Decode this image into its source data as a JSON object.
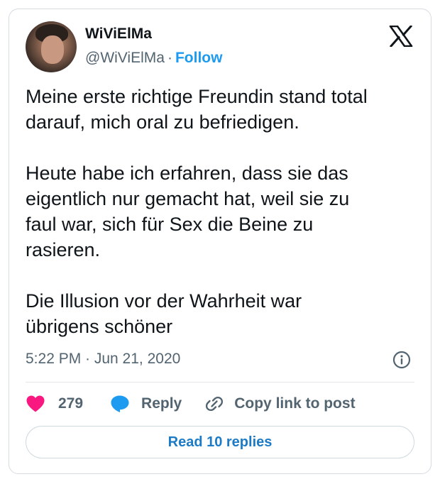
{
  "author": {
    "display_name": "WiViElMa",
    "handle": "@WiViElMa",
    "separator": "·",
    "follow_label": "Follow"
  },
  "tweet": {
    "text": "Meine erste richtige Freundin stand total\ndarauf, mich oral zu befriedigen.\n\nHeute habe ich erfahren, dass sie das\neigentlich nur gemacht hat, weil sie zu\nfaul war, sich für Sex die Beine zu\nrasieren.\n\nDie Illusion vor der Wahrheit war\nübrigens schöner",
    "timestamp": "5:22 PM · Jun 21, 2020"
  },
  "actions": {
    "like_count": "279",
    "reply_label": "Reply",
    "copy_link_label": "Copy link to post"
  },
  "read_replies_label": "Read 10 replies",
  "icons": {
    "logo": "x-logo-icon",
    "info": "info-icon",
    "like": "heart-icon",
    "reply": "speech-bubble-icon",
    "copy": "link-icon"
  },
  "colors": {
    "accent": "#1d9bf0",
    "like": "#f91880",
    "text": "#0f1419",
    "muted": "#536471"
  }
}
